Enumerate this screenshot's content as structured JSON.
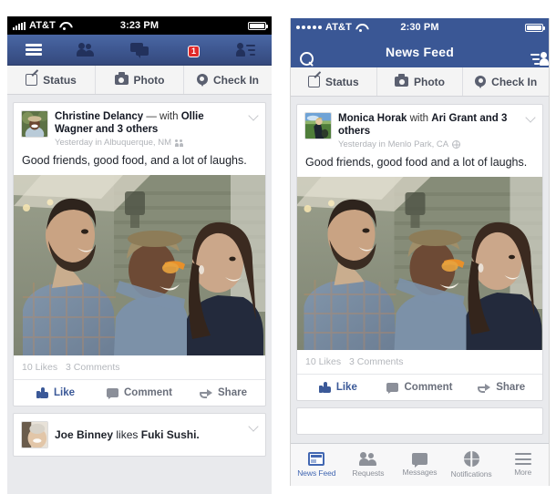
{
  "left_phone": {
    "statusbar": {
      "carrier": "AT&T",
      "time": "3:23 PM"
    },
    "navbar": {
      "menu_icon": "hamburger-icon",
      "friends_icon": "friend-requests-icon",
      "messages_icon": "messages-icon",
      "notifications_icon": "globe-notifications-icon",
      "notification_badge": "1",
      "profile_icon": "friend-list-icon"
    },
    "composer": {
      "status_label": "Status",
      "photo_label": "Photo",
      "checkin_label": "Check In"
    },
    "post": {
      "author": "Christine Delancy",
      "connector": "— with",
      "tagged": "Ollie Wagner",
      "others": "and 3 others",
      "meta": "Yesterday in Albuquerque, NM",
      "privacy_icon": "friends-icon",
      "story": "Good friends, good food, and a lot of laughs.",
      "likes": "10 Likes",
      "comments": "3 Comments",
      "like_label": "Like",
      "comment_label": "Comment",
      "share_label": "Share"
    },
    "post2": {
      "author": "Joe Binney",
      "action": "likes",
      "object": "Fuki Sushi."
    }
  },
  "right_phone": {
    "statusbar": {
      "carrier": "AT&T",
      "time": "2:30 PM"
    },
    "navbar": {
      "search_icon": "search-icon",
      "title": "News Feed",
      "profile_icon": "friend-list-icon"
    },
    "composer": {
      "status_label": "Status",
      "photo_label": "Photo",
      "checkin_label": "Check In"
    },
    "post": {
      "author": "Monica Horak",
      "connector": "with",
      "tagged": "Ari Grant",
      "others": "and 3 others",
      "meta": "Yesterday in Menlo Park, CA",
      "privacy_icon": "globe-icon",
      "story": "Good friends, good food and a lot of laughs.",
      "likes": "10 Likes",
      "comments": "3 Comments",
      "like_label": "Like",
      "comment_label": "Comment",
      "share_label": "Share"
    },
    "tabbar": [
      {
        "label": "News Feed",
        "icon": "news-feed-icon",
        "active": true
      },
      {
        "label": "Requests",
        "icon": "requests-icon",
        "active": false
      },
      {
        "label": "Messages",
        "icon": "messages-icon",
        "active": false
      },
      {
        "label": "Notifications",
        "icon": "notifications-globe-icon",
        "active": false
      },
      {
        "label": "More",
        "icon": "more-hamburger-icon",
        "active": false
      }
    ]
  },
  "colors": {
    "facebook_blue": "#3a5795",
    "nav_blue_old": "#3d568f",
    "link_blue": "#4267b2",
    "badge_red": "#e02a2a",
    "page_bg": "#e9eaed",
    "card_bg": "#ffffff"
  }
}
